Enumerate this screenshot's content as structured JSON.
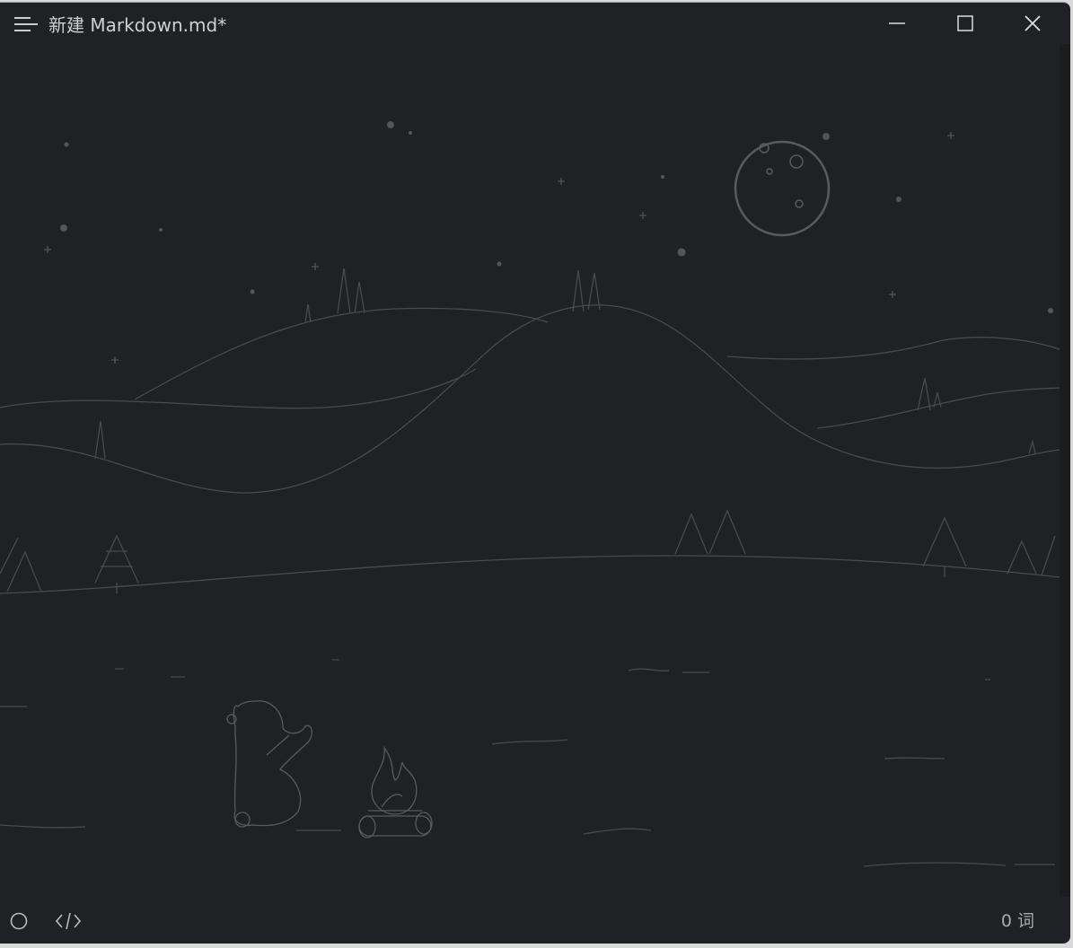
{
  "window": {
    "title": "新建 Markdown.md",
    "modified_marker": "*"
  },
  "controls": {
    "minimize_icon": "minimize-icon",
    "maximize_icon": "maximize-icon",
    "close_icon": "close-icon"
  },
  "statusbar": {
    "word_count": "0 词",
    "outline_icon": "circle-icon",
    "source_icon": "code-icon"
  },
  "colors": {
    "background": "#202124",
    "illustration": "#4a4a4d",
    "text": "#d0d0d0"
  }
}
